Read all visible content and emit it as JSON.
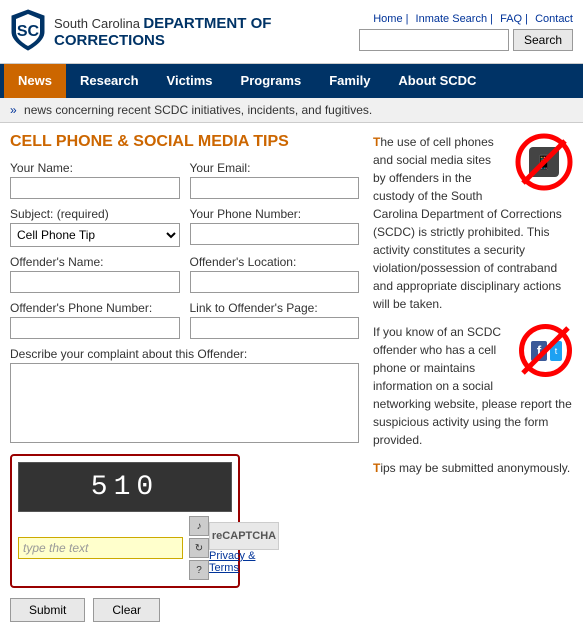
{
  "header": {
    "org_line1": "South Carolina",
    "org_line2": "DEPARTMENT OF CORRECTIONS",
    "links": [
      "Home",
      "Inmate Search",
      "FAQ",
      "Contact"
    ],
    "search_placeholder": "",
    "search_button": "Search"
  },
  "navbar": {
    "items": [
      {
        "label": "News",
        "active": true
      },
      {
        "label": "Research",
        "active": false
      },
      {
        "label": "Victims",
        "active": false
      },
      {
        "label": "Programs",
        "active": false
      },
      {
        "label": "Family",
        "active": false
      },
      {
        "label": "About SCDC",
        "active": false
      }
    ]
  },
  "subheader": {
    "text": "news concerning recent SCDC initiatives, incidents, and fugitives."
  },
  "form": {
    "title": "CELL PHONE & SOCIAL MEDIA TIPS",
    "your_name_label": "Your Name:",
    "your_email_label": "Your Email:",
    "subject_label": "Subject: (required)",
    "subject_options": [
      "Cell Phone Tip"
    ],
    "subject_default": "Cell Phone Tip",
    "phone_label": "Your Phone Number:",
    "offender_name_label": "Offender's Name:",
    "offender_location_label": "Offender's Location:",
    "offender_phone_label": "Offender's Phone Number:",
    "offender_link_label": "Link to Offender's Page:",
    "describe_label": "Describe your complaint about this Offender:",
    "captcha_text": "510",
    "captcha_placeholder": "type the text",
    "privacy_label": "Privacy & Terms",
    "submit_label": "Submit",
    "clear_label": "Clear"
  },
  "info": {
    "paragraph1": "The use of cell phones and social media sites by offenders in the custody of the South Carolina Department of Corrections (SCDC) is strictly prohibited. This activity constitutes a security violation/possession of contraband and appropriate disciplinary actions will be taken.",
    "paragraph2": "If you know of an SCDC offender who has a cell phone or maintains information on a social networking website, please report the suspicious activity using the form provided.",
    "paragraph3": "Tips may be submitted anonymously.",
    "highlight_tips": "T",
    "highlight_paragraph1_start": "T"
  }
}
